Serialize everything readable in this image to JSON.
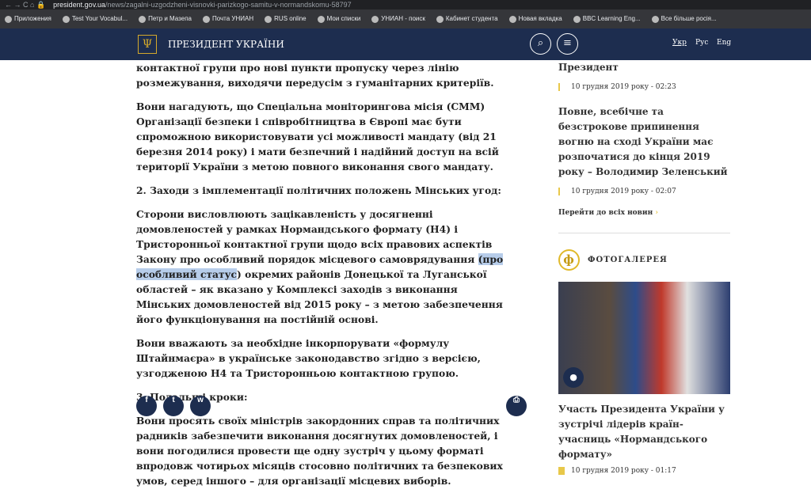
{
  "browser": {
    "host": "president.gov.ua",
    "path": "/news/zagalni-uzgodzheni-visnovki-parizkogo-samitu-v-normandskomu-58797",
    "bookmarks": [
      "Приложения",
      "Test Your Vocabul...",
      "Петр и Мазепа",
      "Почта УНИАН",
      "RUS online",
      "Мои списки",
      "УНИАН - поиск",
      "Кабинет студента",
      "Новая вкладка",
      "BBC Learning Eng...",
      "Все більше росія..."
    ]
  },
  "header": {
    "title": "ПРЕЗИДЕНТ УКРАЇНИ",
    "langs": [
      "Укр",
      "Рус",
      "Eng"
    ]
  },
  "article": {
    "p1": "контактної групи про нові пункти пропуску через лінію розмежування, виходячи передусім з гуманітарних критеріїв.",
    "p2": "Вони нагадують, що Спеціальна моніторингова місія (СММ) Організації безпеки і співробітництва в Європі має бути спроможною використовувати  усі можливості мандату (від 21 березня 2014 року) і мати безпечний і надійний доступ на всій території України з метою повного виконання свого мандату.",
    "h2": "2. Заходи з імплементації політичних положень Мінських угод:",
    "p3a": "Сторони висловлюють зацікавленість у досягненні домовленостей у рамках Нормандського формату (Н4) і Тристоронньої контактної групи щодо всіх правових аспектів Закону про особливий порядок місцевого самоврядування ",
    "p3hl": "(про особливий статус",
    "p3b": ") окремих районів Донецької та Луганської областей – як вказано у Комплексі заходів з виконання Мінських домовленостей від 2015 року – з метою забезпечення його функціонування на постійній основі.",
    "p4": "Вони вважають за необхідне інкорпорувати «формулу Штайнмаєра» в українське законодавство згідно з версією, узгодженою Н4 та Тристоронньою контактною групою.",
    "h3": "3. Подальші кроки:",
    "p5": "Вони просять своїх міністрів закордонних справ та політичних радників забезпечити виконання досягнутих домовленостей, і вони погодилися провести ще одну зустріч у цьому форматі впродовж чотирьох місяців стосовно політичних та безпекових умов, серед іншого – для організації місцевих виборів."
  },
  "share": {
    "facebook": "f",
    "twitter": "t",
    "whatsapp": "w",
    "print": "⎙"
  },
  "sidebar": {
    "news": [
      {
        "title": "Президент",
        "date": "10 грудня 2019 року - 02:23"
      },
      {
        "title": "Повне, всебічне та безстрокове припинення вогню на сході України має розпочатися до кінця 2019 року – Володимир Зеленський",
        "date": "10 грудня 2019 року - 02:07"
      }
    ],
    "more": "Перейти до всіх новин",
    "gallery_label": "ФОТОГАЛЕРЕЯ",
    "gallery_title": "Участь Президента України у зустрічі лідерів країн-учасниць «Нормандського формату»",
    "gallery_date": "10 грудня 2019 року - 01:17"
  }
}
